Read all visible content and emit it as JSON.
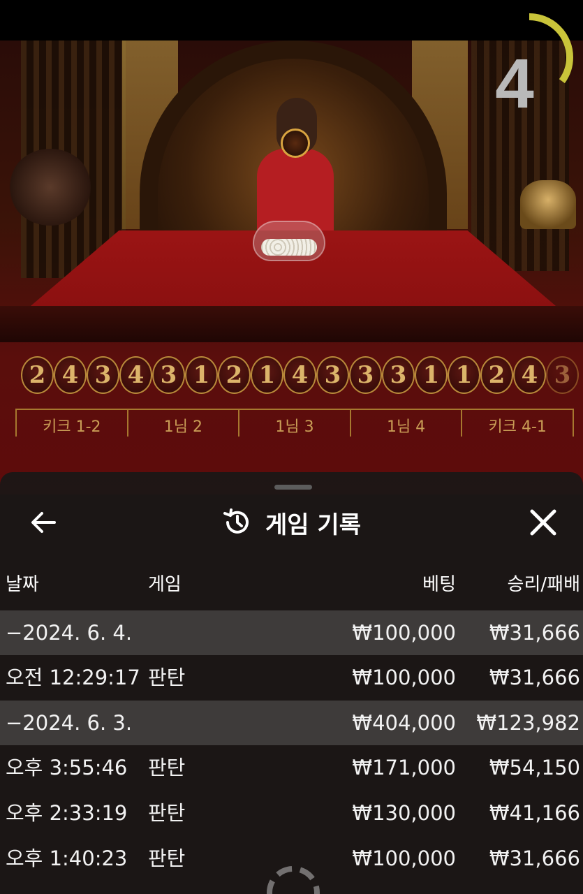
{
  "timer": {
    "value": "4",
    "progress": 0.35,
    "color": "#c9c43a"
  },
  "bead_road": [
    "2",
    "4",
    "3",
    "4",
    "3",
    "1",
    "2",
    "1",
    "4",
    "3",
    "3",
    "3",
    "1",
    "1",
    "2",
    "4",
    "3"
  ],
  "bet_options": [
    "키크 1-2",
    "1님 2",
    "1님 3",
    "1님 4",
    "키크 4-1"
  ],
  "sheet": {
    "title": "게임 기록",
    "back_icon": "arrow-left-icon",
    "history_icon": "history-icon",
    "close_icon": "close-icon"
  },
  "table": {
    "headers": {
      "date": "날짜",
      "game": "게임",
      "bet": "베팅",
      "win_loss": "승리/패배"
    },
    "rows": [
      {
        "type": "group",
        "date": "−2024. 6. 4.",
        "game": "",
        "bet": "₩100,000",
        "win_loss": "₩31,666"
      },
      {
        "type": "item",
        "date": "오전 12:29:17",
        "game": "판탄",
        "bet": "₩100,000",
        "win_loss": "₩31,666"
      },
      {
        "type": "group",
        "date": "−2024. 6. 3.",
        "game": "",
        "bet": "₩404,000",
        "win_loss": "₩123,982"
      },
      {
        "type": "item",
        "date": "오후 3:55:46",
        "game": "판탄",
        "bet": "₩171,000",
        "win_loss": "₩54,150"
      },
      {
        "type": "item",
        "date": "오후 2:33:19",
        "game": "판탄",
        "bet": "₩130,000",
        "win_loss": "₩41,166"
      },
      {
        "type": "item",
        "date": "오후 1:40:23",
        "game": "판탄",
        "bet": "₩100,000",
        "win_loss": "₩31,666"
      }
    ]
  },
  "colors": {
    "sheet_bg": "#1c1716",
    "group_row_bg": "#3e3b3a",
    "bead_gold": "#dcb46a",
    "felt_red": "#9b1414"
  }
}
